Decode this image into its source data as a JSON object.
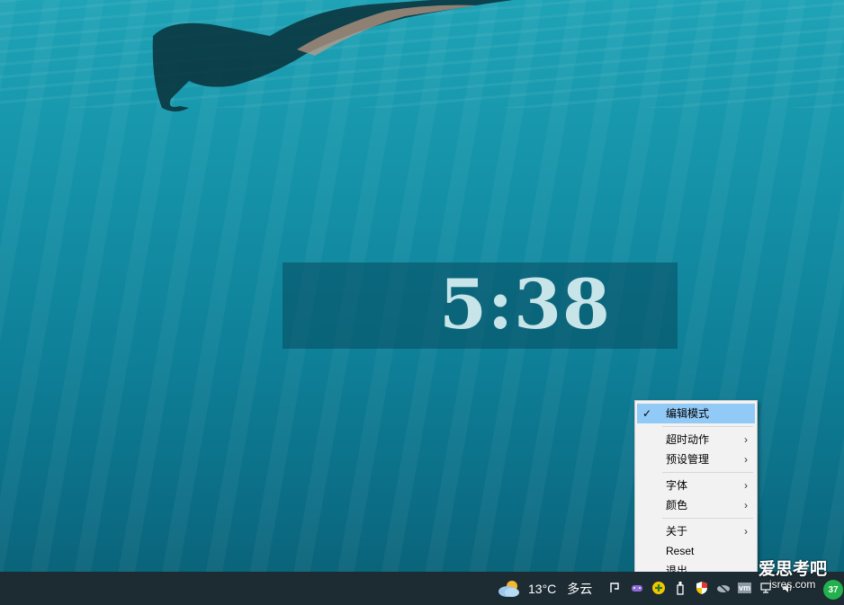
{
  "clock": {
    "time": "5:38"
  },
  "context_menu": {
    "items": [
      {
        "label": "编辑模式",
        "checked": true,
        "submenu": false
      },
      {
        "label": "超时动作",
        "submenu": true
      },
      {
        "label": "预设管理",
        "submenu": true
      },
      {
        "label": "字体",
        "submenu": true
      },
      {
        "label": "颜色",
        "submenu": true
      },
      {
        "label": "关于",
        "submenu": true
      },
      {
        "label": "Reset",
        "submenu": false
      },
      {
        "label": "退出",
        "submenu": false
      }
    ],
    "check_glyph": "✓",
    "arrow_glyph": "›"
  },
  "taskbar": {
    "weather": {
      "temp": "13°C",
      "desc": "多云",
      "icon": "partly-cloudy-icon"
    },
    "tray_icons": [
      "pen-icon",
      "game-controller-icon",
      "plus-circle-icon",
      "usb-icon",
      "shield-icon",
      "cloud-offline-icon",
      "vm-icon",
      "network-icon",
      "speaker-icon"
    ],
    "vm_label": "vm",
    "notification_count": "37"
  },
  "watermark": {
    "line1": "爱思考吧",
    "line2": "isres.com"
  },
  "colors": {
    "menu_bg": "#f2f2f2",
    "menu_highlight": "#91c9f7",
    "taskbar": "#1d2b33",
    "badge": "#22b14c"
  }
}
